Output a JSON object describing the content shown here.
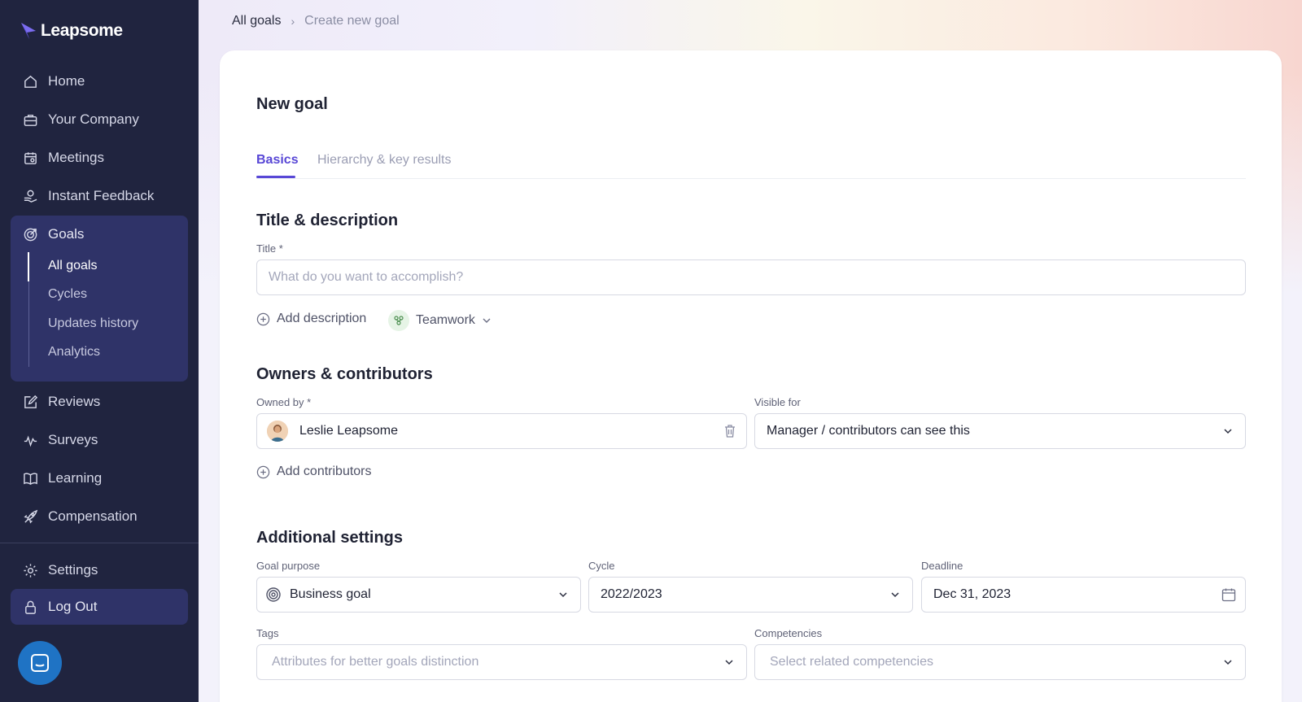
{
  "app": {
    "logo_text": "Leapsome"
  },
  "sidebar": {
    "items": [
      {
        "label": "Home",
        "icon": "home-icon"
      },
      {
        "label": "Your Company",
        "icon": "briefcase-icon"
      },
      {
        "label": "Meetings",
        "icon": "calendar-icon"
      },
      {
        "label": "Instant Feedback",
        "icon": "feedback-hand-icon"
      },
      {
        "label": "Goals",
        "icon": "target-icon"
      },
      {
        "label": "Reviews",
        "icon": "edit-icon"
      },
      {
        "label": "Surveys",
        "icon": "pulse-icon"
      },
      {
        "label": "Learning",
        "icon": "book-icon"
      },
      {
        "label": "Compensation",
        "icon": "rocket-icon"
      }
    ],
    "goals_subitems": [
      "All goals",
      "Cycles",
      "Updates history",
      "Analytics"
    ],
    "active_subitem": "All goals",
    "settings_label": "Settings",
    "logout_label": "Log Out"
  },
  "breadcrumb": {
    "parent": "All goals",
    "separator": "›",
    "current": "Create new goal"
  },
  "page": {
    "title": "New goal",
    "tabs": [
      {
        "label": "Basics",
        "active": true
      },
      {
        "label": "Hierarchy & key results",
        "active": false
      }
    ]
  },
  "title_section": {
    "heading": "Title & description",
    "title_label": "Title *",
    "title_placeholder": "What do you want to accomplish?",
    "title_value": "",
    "add_description": "Add description",
    "category": "Teamwork"
  },
  "owners_section": {
    "heading": "Owners & contributors",
    "owned_by_label": "Owned by *",
    "owner_name": "Leslie Leapsome",
    "visible_for_label": "Visible for",
    "visible_for_value": "Manager / contributors can see this",
    "add_contributors": "Add contributors"
  },
  "additional_section": {
    "heading": "Additional settings",
    "goal_purpose_label": "Goal purpose",
    "goal_purpose_value": "Business goal",
    "cycle_label": "Cycle",
    "cycle_value": "2022/2023",
    "deadline_label": "Deadline",
    "deadline_value": "Dec 31, 2023",
    "tags_label": "Tags",
    "tags_placeholder": "Attributes for better goals distinction",
    "competencies_label": "Competencies",
    "competencies_placeholder": "Select related competencies"
  },
  "colors": {
    "sidebar_bg": "#20243f",
    "sidebar_active_bg": "#2f3368",
    "accent": "#5847d6",
    "chat_button": "#1f73c4"
  }
}
